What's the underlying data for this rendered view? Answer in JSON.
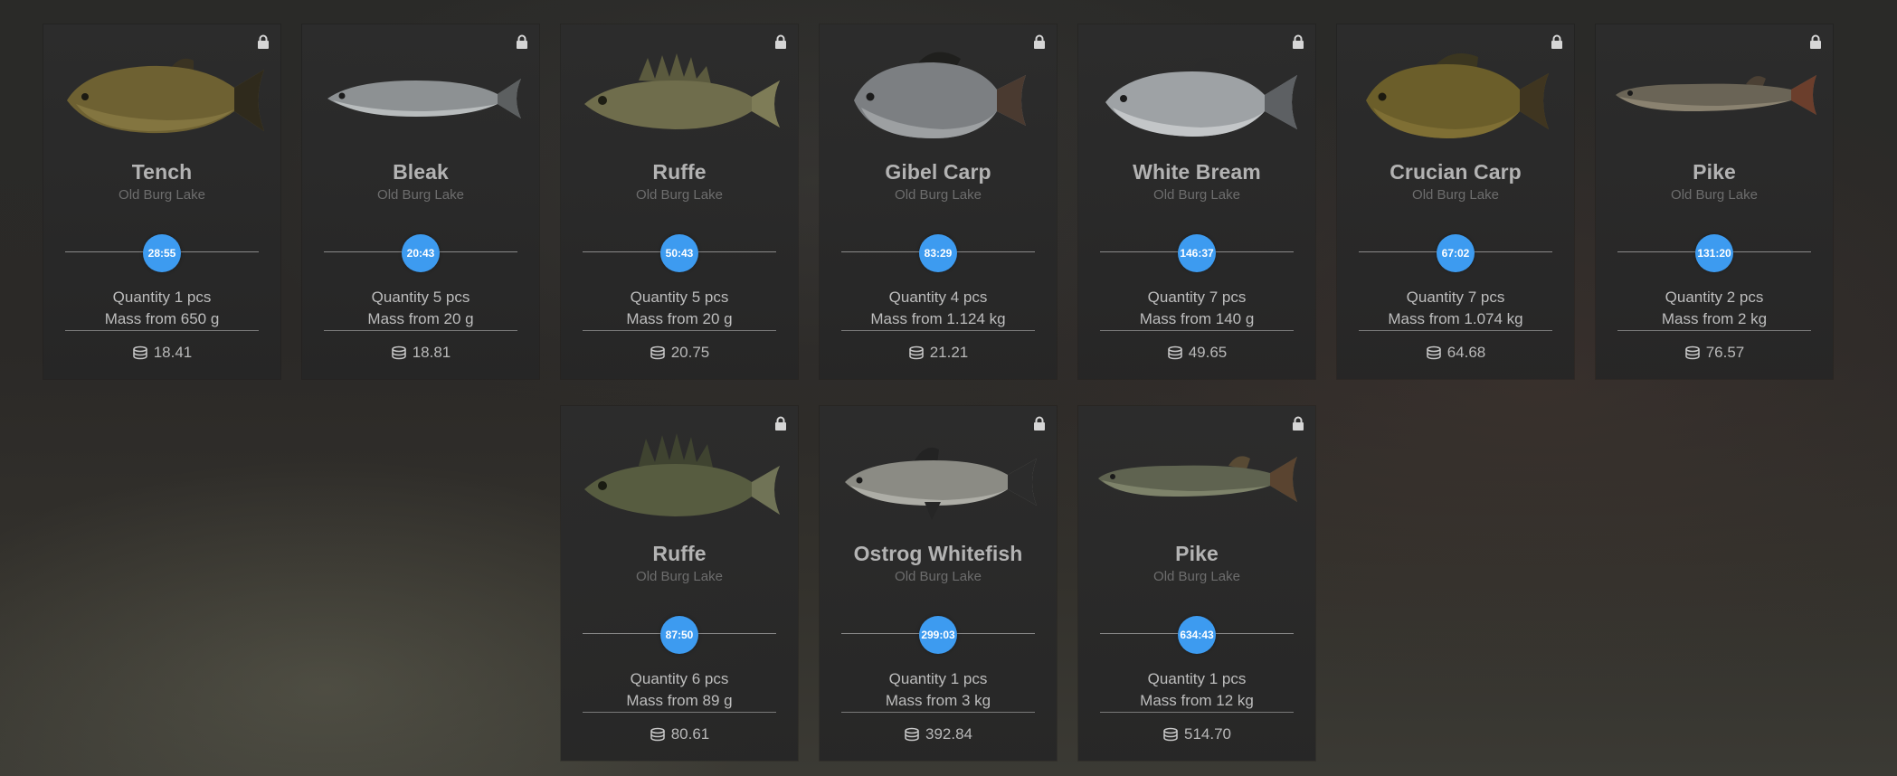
{
  "cards": [
    {
      "name": "Tench",
      "location": "Old Burg Lake",
      "timer": "28:55",
      "quantity": "Quantity 1 pcs",
      "mass": "Mass from 650 g",
      "price": "18.41",
      "fish_icon": "tench-fish-icon"
    },
    {
      "name": "Bleak",
      "location": "Old Burg Lake",
      "timer": "20:43",
      "quantity": "Quantity 5 pcs",
      "mass": "Mass from 20 g",
      "price": "18.81",
      "fish_icon": "bleak-fish-icon"
    },
    {
      "name": "Ruffe",
      "location": "Old Burg Lake",
      "timer": "50:43",
      "quantity": "Quantity 5 pcs",
      "mass": "Mass from 20 g",
      "price": "20.75",
      "fish_icon": "ruffe-fish-icon"
    },
    {
      "name": "Gibel Carp",
      "location": "Old Burg Lake",
      "timer": "83:29",
      "quantity": "Quantity 4 pcs",
      "mass": "Mass from 1.124 kg",
      "price": "21.21",
      "fish_icon": "gibel-carp-fish-icon"
    },
    {
      "name": "White Bream",
      "location": "Old Burg Lake",
      "timer": "146:37",
      "quantity": "Quantity 7 pcs",
      "mass": "Mass from 140 g",
      "price": "49.65",
      "fish_icon": "white-bream-fish-icon"
    },
    {
      "name": "Crucian Carp",
      "location": "Old Burg Lake",
      "timer": "67:02",
      "quantity": "Quantity 7 pcs",
      "mass": "Mass from 1.074 kg",
      "price": "64.68",
      "fish_icon": "crucian-carp-fish-icon"
    },
    {
      "name": "Pike",
      "location": "Old Burg Lake",
      "timer": "131:20",
      "quantity": "Quantity 2 pcs",
      "mass": "Mass from 2 kg",
      "price": "76.57",
      "fish_icon": "pike-fish-icon"
    },
    {
      "name": "Ruffe",
      "location": "Old Burg Lake",
      "timer": "87:50",
      "quantity": "Quantity 6 pcs",
      "mass": "Mass from 89 g",
      "price": "80.61",
      "fish_icon": "ruffe-fish-icon"
    },
    {
      "name": "Ostrog Whitefish",
      "location": "Old Burg Lake",
      "timer": "299:03",
      "quantity": "Quantity 1 pcs",
      "mass": "Mass from 3 kg",
      "price": "392.84",
      "fish_icon": "ostrog-whitefish-fish-icon"
    },
    {
      "name": "Pike",
      "location": "Old Burg Lake",
      "timer": "634:43",
      "quantity": "Quantity 1 pcs",
      "mass": "Mass from 12 kg",
      "price": "514.70",
      "fish_icon": "pike-fish-icon"
    }
  ],
  "colors": {
    "timer_badge": "#3d9bf0",
    "card_bg": "#2b2b2b",
    "name_text": "#b3b3b3",
    "location_text": "#6d6d6d"
  }
}
